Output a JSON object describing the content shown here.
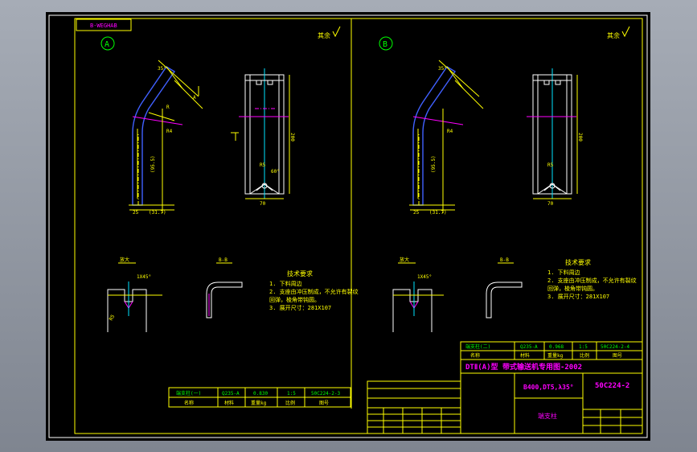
{
  "drawing": {
    "tag_label": "B-WEGHAB",
    "view_a_label": "A",
    "view_b_label": "B",
    "roughness_a": "其余",
    "roughness_b": "其余",
    "section_label": "B-B",
    "detail_label": "放大",
    "chamfer": "1X45°",
    "tech_title": "技术要求",
    "tech_items": [
      "1. 下料周边",
      "2. 支座由冲压制成，不允许有裂纹",
      "   回弹，棱角带钝圆。",
      "3. 展开尺寸：281X107"
    ],
    "title_block": {
      "main_title": "DTⅡ(A)型  带式输送机专用图-2002",
      "spec": "B400,DT5,λ35°",
      "drawing_no": "50C224-2",
      "part_name": "端支柱",
      "rows": [
        "端支柱(二)",
        "Q235-A",
        "0.968",
        "1:5",
        "50C224-2-4"
      ],
      "headers": [
        "名称",
        "材料",
        "重量kg",
        "比例",
        "图号"
      ]
    },
    "left_bom": {
      "rows": [
        "端支柱(一)",
        "Q235-A",
        "0.830",
        "1:5",
        "50C224-2-3"
      ],
      "headers": [
        "名称",
        "材料",
        "重量kg",
        "比例",
        "图号"
      ]
    }
  }
}
